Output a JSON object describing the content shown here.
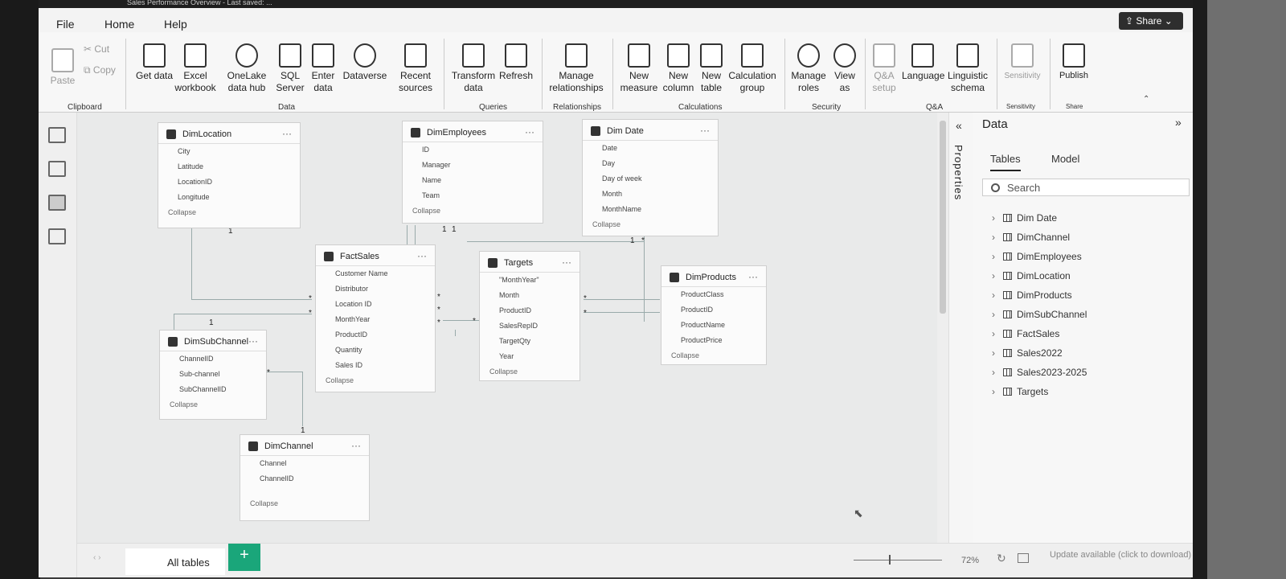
{
  "window": {
    "title": "Sales Performance Overview - Last saved: ..."
  },
  "menu": {
    "file": "File",
    "home": "Home",
    "help": "Help",
    "share": "Share"
  },
  "ribbon": {
    "clipboard": {
      "paste": "Paste",
      "cut": "Cut",
      "copy": "Copy",
      "group": "Clipboard"
    },
    "data": {
      "get_data": "Get data",
      "excel": "Excel workbook",
      "onelake": "OneLake data hub",
      "sql": "SQL Server",
      "enter": "Enter data",
      "dataverse": "Dataverse",
      "recent": "Recent sources",
      "group": "Data"
    },
    "queries": {
      "transform": "Transform data",
      "refresh": "Refresh",
      "group": "Queries"
    },
    "relationships": {
      "manage": "Manage relationships",
      "group": "Relationships"
    },
    "calculations": {
      "new_measure": "New measure",
      "new_column": "New column",
      "new_table": "New table",
      "calc_group": "Calculation group",
      "group": "Calculations"
    },
    "security": {
      "manage_roles": "Manage roles",
      "view_as": "View as",
      "group": "Security"
    },
    "qa": {
      "qa_setup": "Q&A setup",
      "language": "Language",
      "linguistic": "Linguistic schema",
      "group": "Q&A"
    },
    "sensitivity": {
      "label": "Sensitivity",
      "group": "Sensitivity"
    },
    "share": {
      "publish": "Publish",
      "group": "Share"
    }
  },
  "tables": {
    "dimlocation": {
      "name": "DimLocation",
      "fields": [
        "City",
        "Latitude",
        "LocationID",
        "Longitude"
      ],
      "collapse": "Collapse"
    },
    "dimemployees": {
      "name": "DimEmployees",
      "fields": [
        "ID",
        "Manager",
        "Name",
        "Team"
      ],
      "collapse": "Collapse"
    },
    "dimdate": {
      "name": "Dim Date",
      "fields": [
        "Date",
        "Day",
        "Day of week",
        "Month",
        "MonthName"
      ],
      "collapse": "Collapse"
    },
    "factsales": {
      "name": "FactSales",
      "fields": [
        "Customer Name",
        "Distributor",
        "Location ID",
        "MonthYear",
        "ProductID",
        "Quantity",
        "Sales ID"
      ],
      "collapse": "Collapse"
    },
    "targets": {
      "name": "Targets",
      "fields": [
        "\"MonthYear\"",
        "Month",
        "ProductID",
        "SalesRepID",
        "TargetQty",
        "Year"
      ],
      "collapse": "Collapse"
    },
    "dimproducts": {
      "name": "DimProducts",
      "fields": [
        "ProductClass",
        "ProductID",
        "ProductName",
        "ProductPrice"
      ],
      "collapse": "Collapse"
    },
    "dimsubchannel": {
      "name": "DimSubChannel",
      "fields": [
        "ChannelID",
        "Sub-channel",
        "SubChannelID"
      ],
      "collapse": "Collapse"
    },
    "dimchannel": {
      "name": "DimChannel",
      "fields": [
        "Channel",
        "ChannelID"
      ],
      "collapse": "Collapse"
    }
  },
  "cardinality": {
    "one": "1",
    "many": "*"
  },
  "properties": {
    "label": "Properties"
  },
  "datapane": {
    "title": "Data",
    "tabs": {
      "tables": "Tables",
      "model": "Model"
    },
    "search_placeholder": "Search",
    "items": [
      "Dim Date",
      "DimChannel",
      "DimEmployees",
      "DimLocation",
      "DimProducts",
      "DimSubChannel",
      "FactSales",
      "Sales2022",
      "Sales2023-2025",
      "Targets"
    ]
  },
  "bottom": {
    "all_tables": "All tables",
    "add": "+",
    "zoom": "72%",
    "update": "Update available (click to download)"
  }
}
